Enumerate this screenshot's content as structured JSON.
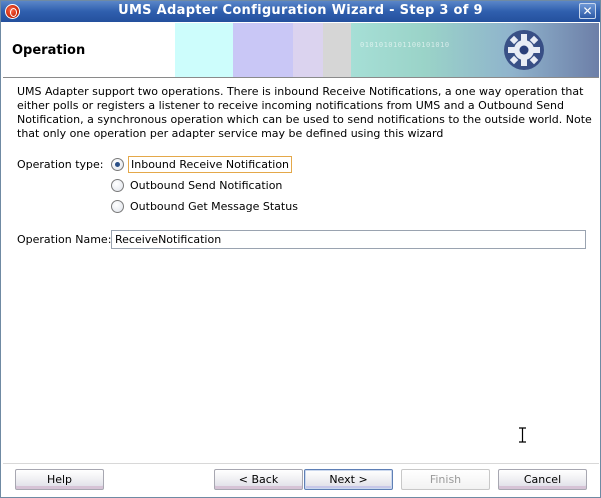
{
  "window": {
    "title": "UMS Adapter Configuration Wizard - Step 3 of 9",
    "close_glyph": "✕",
    "app_icon": "oracle-logo-icon"
  },
  "header": {
    "title": "Operation",
    "banner_binary": "0101010101100101010"
  },
  "description": "UMS Adapter support two operations. There is inbound Receive Notifications, a one way operation that either polls or registers a listener to receive incoming notifications from UMS and a Outbound Send Notification, a synchronous operation which can be used to send notifications to the outside world. Note that only one operation per adapter service may be defined using this wizard",
  "operation_type": {
    "label": "Operation type:",
    "options": [
      {
        "label": "Inbound Receive Notification",
        "checked": true
      },
      {
        "label": "Outbound Send Notification",
        "checked": false
      },
      {
        "label": "Outbound Get Message Status",
        "checked": false
      }
    ]
  },
  "operation_name": {
    "label": "Operation Name:",
    "value": "ReceiveNotification"
  },
  "buttons": {
    "help": "Help",
    "back": "< Back",
    "next": "Next >",
    "finish": "Finish",
    "cancel": "Cancel"
  },
  "colors": {
    "titlebar": "#2f5fae",
    "focus_border": "#e4a84a",
    "default_button_border": "#5e7fb5"
  }
}
